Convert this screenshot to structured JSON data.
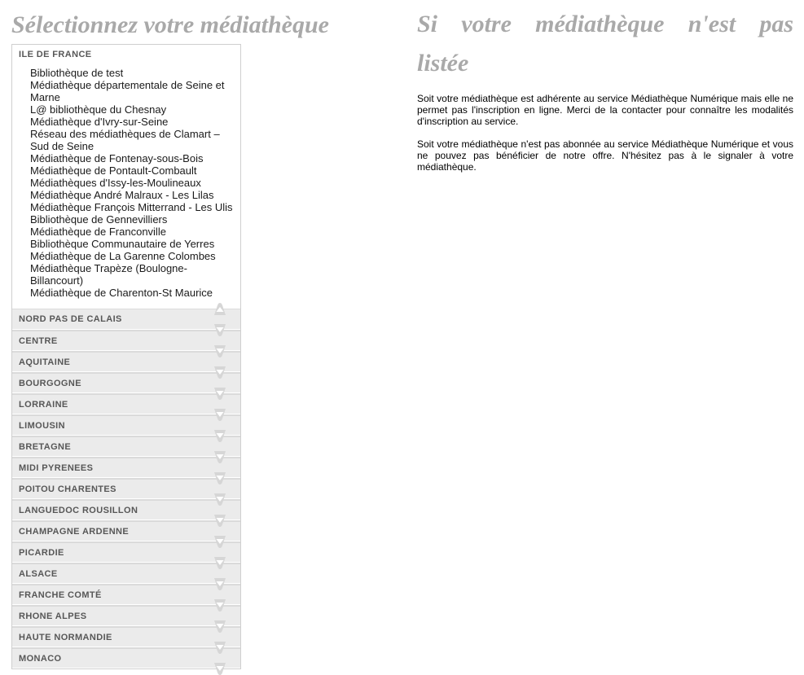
{
  "page": {
    "left_heading": "Sélectionnez votre médiathèque",
    "right_heading_line1": "Si votre médiathèque n'est pas",
    "right_heading_line2": "listée",
    "heading_color": "#a9a9a9"
  },
  "accordion": {
    "open_section": {
      "label": "ILE DE FRANCE",
      "chevron_icon": "chevron-up-icon",
      "items": [
        "Bibliothèque de test",
        "Médiathèque départementale de Seine et Marne",
        "L@ bibliothèque du Chesnay",
        "Médiathèque d'Ivry-sur-Seine",
        "Réseau des médiathèques de Clamart – Sud de Seine",
        "Médiathèque de Fontenay-sous-Bois",
        "Médiathèque de Pontault-Combault",
        "Médiathèques d'Issy-les-Moulineaux",
        "Médiathèque André Malraux - Les Lilas",
        "Médiathèque François Mitterrand - Les Ulis",
        "Bibliothèque de Gennevilliers",
        "Médiathèque de Franconville",
        "Bibliothèque Communautaire de Yerres",
        "Médiathèque de La Garenne Colombes",
        "Médiathèque Trapèze (Boulogne-Billancourt)",
        "Médiathèque de Charenton-St Maurice"
      ]
    },
    "collapsed_sections": [
      {
        "label": "NORD PAS DE CALAIS",
        "chevron_icon": "chevron-down-icon"
      },
      {
        "label": "CENTRE",
        "chevron_icon": "chevron-down-icon"
      },
      {
        "label": "AQUITAINE",
        "chevron_icon": "chevron-down-icon"
      },
      {
        "label": "BOURGOGNE",
        "chevron_icon": "chevron-down-icon"
      },
      {
        "label": "LORRAINE",
        "chevron_icon": "chevron-down-icon"
      },
      {
        "label": "LIMOUSIN",
        "chevron_icon": "chevron-down-icon"
      },
      {
        "label": "BRETAGNE",
        "chevron_icon": "chevron-down-icon"
      },
      {
        "label": "MIDI PYRENEES",
        "chevron_icon": "chevron-down-icon"
      },
      {
        "label": "POITOU CHARENTES",
        "chevron_icon": "chevron-down-icon"
      },
      {
        "label": "LANGUEDOC ROUSILLON",
        "chevron_icon": "chevron-down-icon"
      },
      {
        "label": "CHAMPAGNE ARDENNE",
        "chevron_icon": "chevron-down-icon"
      },
      {
        "label": "PICARDIE",
        "chevron_icon": "chevron-down-icon"
      },
      {
        "label": "ALSACE",
        "chevron_icon": "chevron-down-icon"
      },
      {
        "label": "FRANCHE COMTÉ",
        "chevron_icon": "chevron-down-icon"
      },
      {
        "label": "RHONE ALPES",
        "chevron_icon": "chevron-down-icon"
      },
      {
        "label": "HAUTE NORMANDIE",
        "chevron_icon": "chevron-down-icon"
      },
      {
        "label": "MONACO",
        "chevron_icon": "chevron-down-icon"
      }
    ]
  },
  "right_column": {
    "paragraphs": [
      "Soit votre médiathèque est adhérente au service Médiathèque Numérique mais elle ne permet pas l'inscription en ligne. Merci de la contacter pour connaître les modalités d'inscription au service.",
      "Soit votre médiathèque n'est pas abonnée au service Médiathèque Numérique et vous ne pouvez pas bénéficier de notre offre. N'hésitez pas à le signaler à votre médiathèque."
    ]
  },
  "colors": {
    "header_bg": "#ebebeb",
    "header_text": "#575757",
    "panel_border": "#cfcfcf",
    "chevron_fill": "#d6d6d6",
    "body_text": "#000000"
  }
}
